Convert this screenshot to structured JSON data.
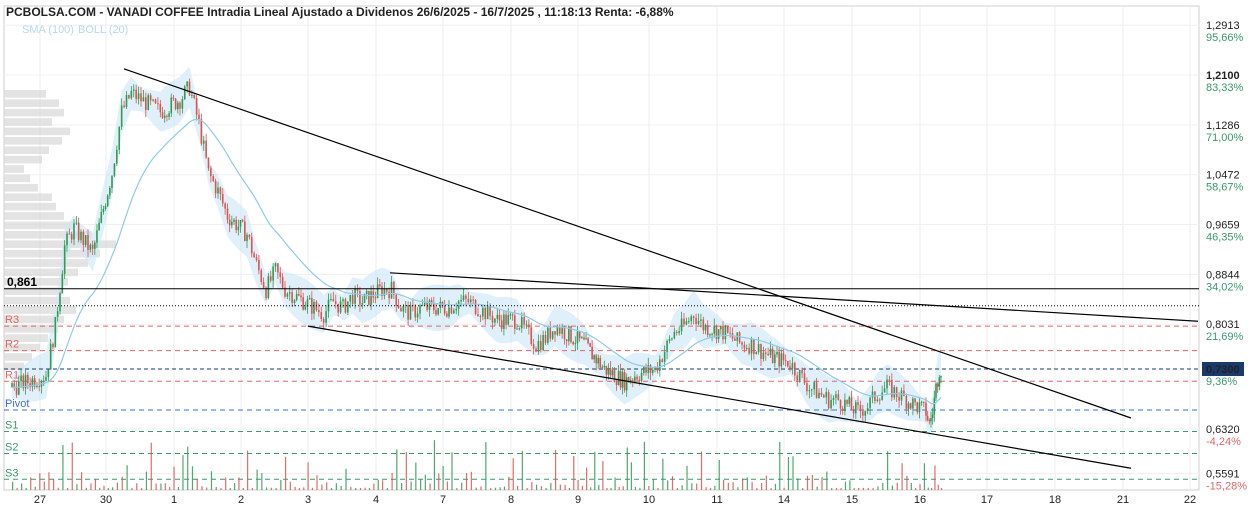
{
  "header": {
    "title": "PCBOLSA.COM - VANADI COFFEE Intradia Lineal Ajustado a Dividenos 26/6/2025 - 16/7/2025 , 11:18:13 Renta: -6,88%",
    "indicators": [
      "SMA (100)",
      "BOLL (20)"
    ]
  },
  "colors": {
    "up": "#2e9a52",
    "down": "#d9534f",
    "sma": "#8fcbe8",
    "boll_fill": "#cfe8f7",
    "resistance": "#e06666",
    "support": "#3a9a6a",
    "pivot": "#3b6fd6",
    "trendline": "#000000",
    "volume_profile": "#d9d9d9"
  },
  "chart_data": {
    "type": "candlestick",
    "title": "PCBOLSA.COM - VANADI COFFEE Intradia Lineal Ajustado a Dividenos 26/6/2025 - 16/7/2025 , 11:18:13 Renta: -6,88%",
    "x_tick_labels": [
      "27",
      "30",
      "1",
      "2",
      "3",
      "4",
      "7",
      "8",
      "9",
      "10",
      "11",
      "14",
      "15",
      "16",
      "17",
      "18",
      "21",
      "22"
    ],
    "y_range": [
      0.52,
      1.3
    ],
    "y_ticks": [
      {
        "price": "1,2913",
        "pct": "95,66%"
      },
      {
        "price": "1,2100",
        "pct": "83,33%"
      },
      {
        "price": "1,1286",
        "pct": "71,00%"
      },
      {
        "price": "1,0472",
        "pct": "58,67%"
      },
      {
        "price": "0,9659",
        "pct": "46,35%"
      },
      {
        "price": "0,8844",
        "pct": "34,02%"
      },
      {
        "price": "0,8031",
        "pct": "21,69%"
      },
      {
        "price": "0,7300",
        "pct": "9,36%"
      },
      {
        "price": "0,6320",
        "pct": "-4,24%"
      },
      {
        "price": "0,5591",
        "pct": "-15,28%"
      }
    ],
    "last_price": "0,7300",
    "marker_line": {
      "label": "0,861",
      "value": 0.861
    },
    "pivot_levels": [
      {
        "name": "R3",
        "value": 0.8
      },
      {
        "name": "R2",
        "value": 0.76
      },
      {
        "name": "R1",
        "value": 0.71
      },
      {
        "name": "Pivot",
        "value": 0.663
      },
      {
        "name": "S1",
        "value": 0.628
      },
      {
        "name": "S2",
        "value": 0.592
      },
      {
        "name": "S3",
        "value": 0.55
      }
    ],
    "close_series": [
      {
        "session": "27",
        "closes": [
          0.72,
          0.8,
          0.93,
          0.96,
          0.94,
          0.92
        ]
      },
      {
        "session": "30",
        "closes": [
          1.05,
          1.15,
          1.18,
          1.17,
          1.16,
          1.15
        ]
      },
      {
        "session": "1",
        "closes": [
          1.17,
          1.19,
          1.13,
          1.05,
          1.02,
          0.98
        ]
      },
      {
        "session": "2",
        "closes": [
          0.95,
          0.9,
          0.86,
          0.89,
          0.86,
          0.85
        ]
      },
      {
        "session": "3",
        "closes": [
          0.83,
          0.82,
          0.84,
          0.83,
          0.85,
          0.84
        ]
      },
      {
        "session": "4",
        "closes": [
          0.86,
          0.86,
          0.83,
          0.82,
          0.83,
          0.83
        ]
      },
      {
        "session": "7",
        "closes": [
          0.83,
          0.84,
          0.84,
          0.83,
          0.82,
          0.81
        ]
      },
      {
        "session": "8",
        "closes": [
          0.81,
          0.79,
          0.77,
          0.78,
          0.8,
          0.79
        ]
      },
      {
        "session": "9",
        "closes": [
          0.77,
          0.75,
          0.73,
          0.72,
          0.71,
          0.72
        ]
      },
      {
        "session": "10",
        "closes": [
          0.73,
          0.76,
          0.79,
          0.8,
          0.82,
          0.8
        ]
      },
      {
        "session": "11",
        "closes": [
          0.79,
          0.78,
          0.77,
          0.77,
          0.76,
          0.75
        ]
      },
      {
        "session": "14",
        "closes": [
          0.74,
          0.72,
          0.7,
          0.69,
          0.68,
          0.68
        ]
      },
      {
        "session": "15",
        "closes": [
          0.66,
          0.67,
          0.69,
          0.7,
          0.69,
          0.68
        ]
      },
      {
        "session": "16",
        "closes": [
          0.66,
          0.64,
          0.66,
          0.7,
          0.73,
          0.73
        ]
      }
    ],
    "trendlines": [
      {
        "from": {
          "x": "30",
          "y": 1.22
        },
        "to": {
          "x": "21",
          "y": 0.65
        }
      },
      {
        "from": {
          "x": "4",
          "y": 0.887
        },
        "to": {
          "x": "22",
          "y": 0.808
        }
      },
      {
        "from": {
          "x": "3",
          "y": 0.8
        },
        "to": {
          "x": "21",
          "y": 0.568
        }
      }
    ],
    "grid": true,
    "legend_position": "top-left"
  }
}
